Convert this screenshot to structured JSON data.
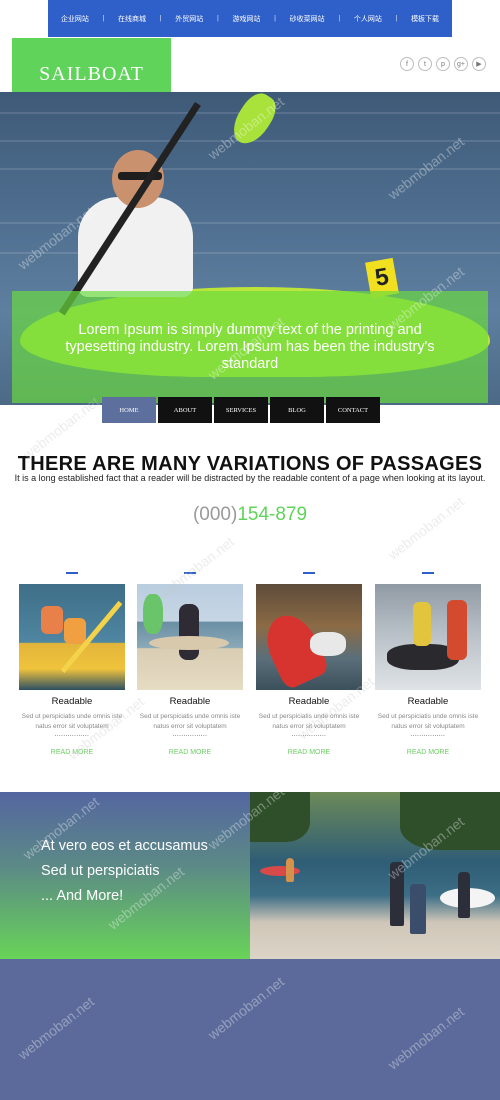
{
  "nav": {
    "items": [
      "企业网站",
      "在线商城",
      "外贸网站",
      "游戏网站",
      "砂收菜网站",
      "个人网站",
      "模板下载"
    ]
  },
  "logo": {
    "text": "SAILBOAT"
  },
  "social": [
    {
      "icon": "facebook-icon",
      "glyph": "f"
    },
    {
      "icon": "twitter-icon",
      "glyph": "t"
    },
    {
      "icon": "pinterest-icon",
      "glyph": "p"
    },
    {
      "icon": "google-plus-icon",
      "glyph": "g+"
    },
    {
      "icon": "youtube-icon",
      "glyph": "▶"
    }
  ],
  "hero": {
    "caption": "Lorem Ipsum is simply dummy text of the printing and typesetting industry. Lorem Ipsum has been the industry's standard",
    "kayak_number": "5"
  },
  "tabs": [
    {
      "label": "HOME",
      "active": true
    },
    {
      "label": "ABOUT",
      "active": false
    },
    {
      "label": "SERVICES",
      "active": false
    },
    {
      "label": "BLOG",
      "active": false
    },
    {
      "label": "CONTACT",
      "active": false
    }
  ],
  "intro": {
    "heading": "THERE ARE MANY VARIATIONS OF PASSAGES",
    "subtext": "It is a long established fact that a reader will be distracted by the readable content of a page when looking at its layout.",
    "phone_prefix": "(000)",
    "phone_number": "154-879"
  },
  "features": [
    {
      "title": "Readable",
      "text": "Sed ut perspiciatis unde omnis iste natus error sit voluptatem",
      "dots": "................",
      "link": "READ MORE"
    },
    {
      "title": "Readable",
      "text": "Sed ut perspiciatis unde omnis iste natus error sit voluptatem",
      "dots": "................",
      "link": "READ MORE"
    },
    {
      "title": "Readable",
      "text": "Sed ut perspiciatis unde omnis iste natus error sit voluptatem",
      "dots": "................",
      "link": "READ MORE"
    },
    {
      "title": "Readable",
      "text": "Sed ut perspiciatis unde omnis iste natus error sit voluptatem",
      "dots": "................",
      "link": "READ MORE"
    }
  ],
  "promo": {
    "lines": [
      "At vero eos et accusamus",
      "Sed ut perspiciatis",
      "... And More!"
    ]
  },
  "watermark": "webmoban.net",
  "colors": {
    "nav_bg": "#2f5fc8",
    "accent_green": "#5fd35a",
    "tab_active": "#5d6f9d",
    "footer_bg": "#5b6a9a"
  }
}
